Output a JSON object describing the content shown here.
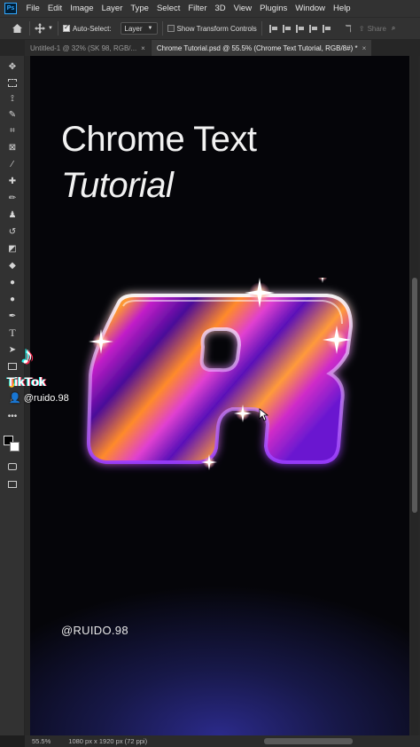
{
  "app": {
    "logo": "Ps"
  },
  "menu": [
    "File",
    "Edit",
    "Image",
    "Layer",
    "Type",
    "Select",
    "Filter",
    "3D",
    "View",
    "Plugins",
    "Window",
    "Help"
  ],
  "options": {
    "auto_select_label": "Auto-Select:",
    "auto_select_checked": true,
    "layer_select_value": "Layer",
    "transform_label": "Show Transform Controls",
    "transform_checked": false,
    "share_label": "Share"
  },
  "tabs": [
    {
      "label": "Untitled-1 @ 32% (SK 98, RGB/...",
      "active": false
    },
    {
      "label": "Chrome Tutorial.psd @ 55.5% (Chrome Text Tutorial, RGB/8#) *",
      "active": true
    }
  ],
  "canvas": {
    "title_line1": "Chrome Text",
    "title_line2": "Tutorial",
    "letter": "R",
    "handle": "@RUIDO.98",
    "colors": {
      "violet": "#7a1cf0",
      "orange": "#ff9a2e",
      "magenta": "#d028c8"
    }
  },
  "tiktok": {
    "word": "TikTok",
    "user": "@ruido.98"
  },
  "status": {
    "zoom": "55.5%",
    "doc_size": "1080 px x 1920 px (72 ppi)"
  },
  "icons": [
    "move-tool-icon",
    "marquee-tool-icon",
    "lasso-tool-icon",
    "magic-wand-icon",
    "crop-tool-icon",
    "frame-tool-icon",
    "eyedropper-icon",
    "healing-brush-icon",
    "brush-tool-icon",
    "stamp-tool-icon",
    "history-brush-icon",
    "eraser-icon",
    "paint-bucket-icon",
    "blur-tool-icon",
    "dodge-tool-icon",
    "pen-tool-icon",
    "type-tool-icon",
    "path-selection-icon",
    "rectangle-tool-icon",
    "hand-tool-icon",
    "zoom-tool-icon",
    "more-tools-icon"
  ]
}
